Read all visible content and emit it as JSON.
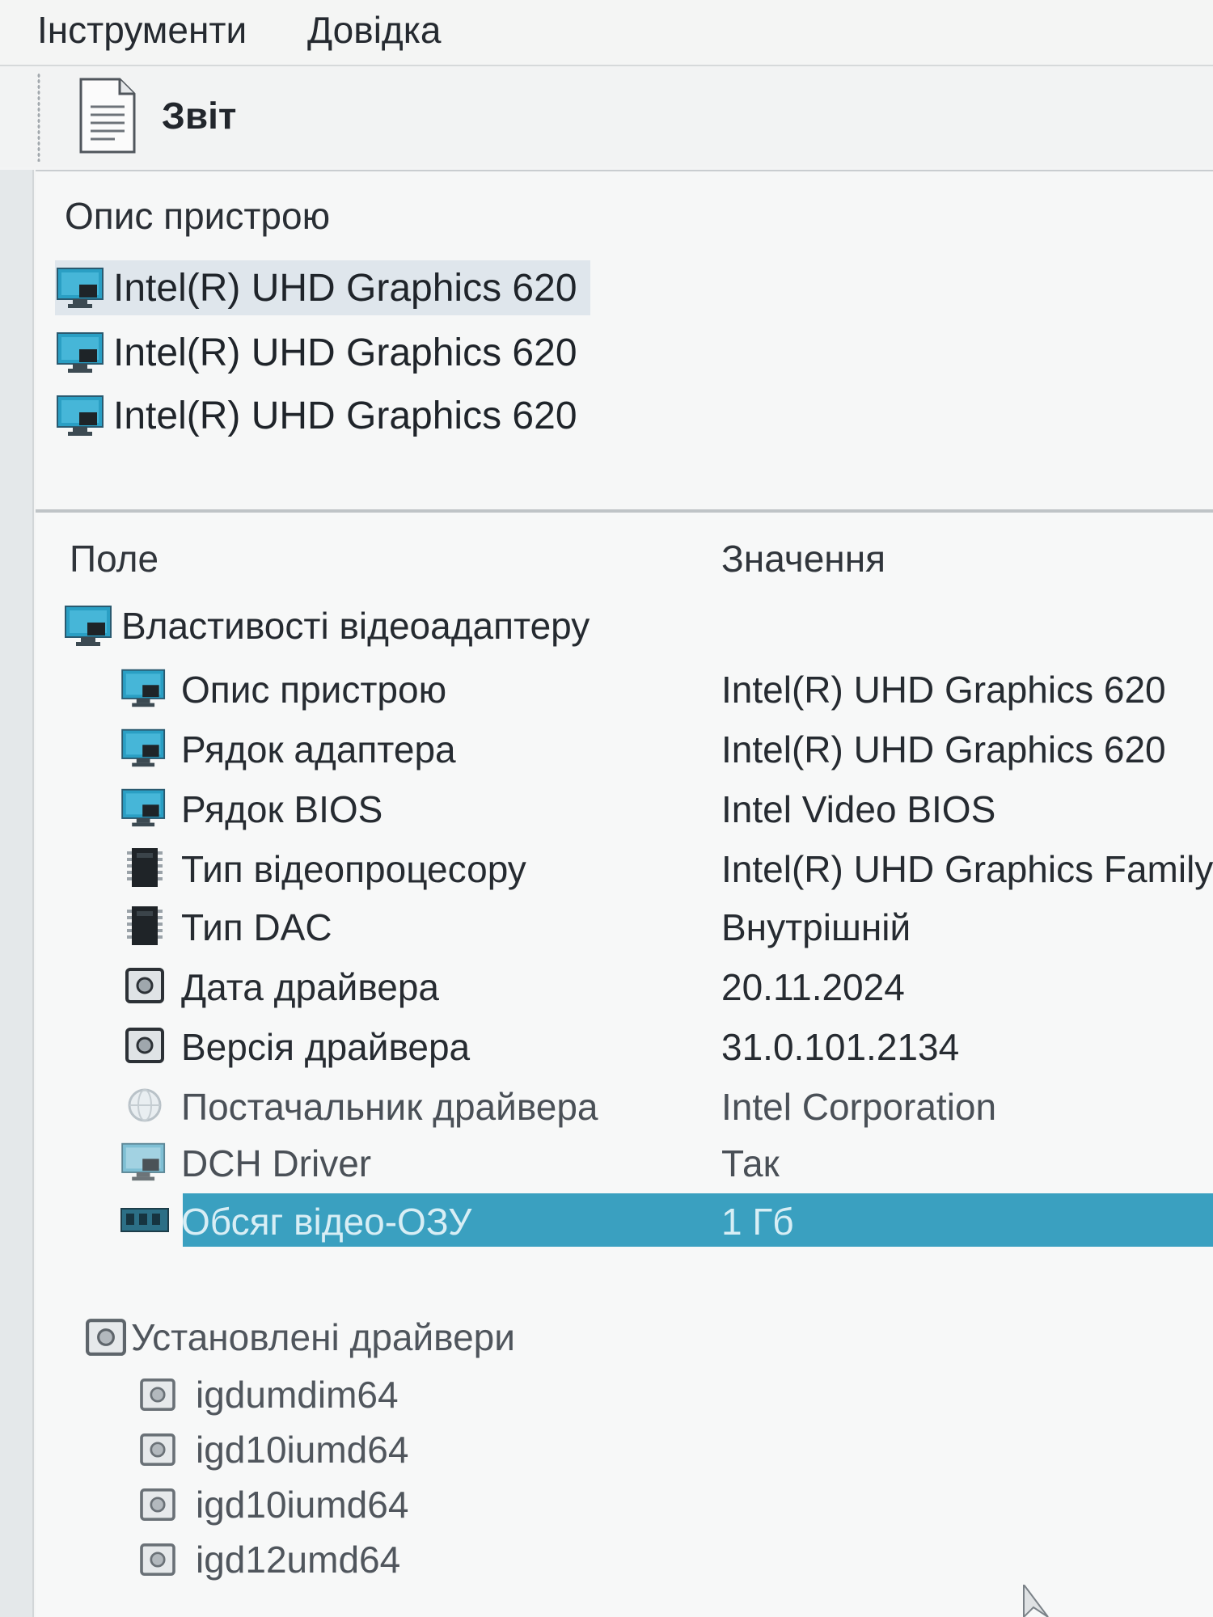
{
  "menu": {
    "tools": "Інструменти",
    "help": "Довідка"
  },
  "toolbar": {
    "report_label": "Звіт",
    "report_icon": "document-icon"
  },
  "device_panel": {
    "header": "Опис пристрою",
    "items": [
      {
        "label": "Intel(R) UHD Graphics 620",
        "icon": "monitor-icon",
        "selected": true
      },
      {
        "label": "Intel(R) UHD Graphics 620",
        "icon": "monitor-icon",
        "selected": false
      },
      {
        "label": "Intel(R) UHD Graphics 620",
        "icon": "monitor-icon",
        "selected": false
      }
    ]
  },
  "properties": {
    "columns": {
      "field": "Поле",
      "value": "Значення"
    },
    "group": {
      "label": "Властивості відеоадаптеру",
      "icon": "monitor-icon"
    },
    "rows": [
      {
        "field": "Опис пристрою",
        "value": "Intel(R) UHD Graphics 620",
        "icon": "monitor-icon"
      },
      {
        "field": "Рядок адаптера",
        "value": "Intel(R) UHD Graphics 620",
        "icon": "monitor-icon"
      },
      {
        "field": "Рядок BIOS",
        "value": "Intel Video BIOS",
        "icon": "monitor-icon"
      },
      {
        "field": "Тип відеопроцесору",
        "value": "Intel(R) UHD Graphics Family",
        "icon": "chip-icon"
      },
      {
        "field": "Тип DAC",
        "value": "Внутрішній",
        "icon": "chip-icon"
      },
      {
        "field": "Дата драйвера",
        "value": "20.11.2024",
        "icon": "driver-icon"
      },
      {
        "field": "Версія драйвера",
        "value": "31.0.101.2134",
        "icon": "driver-icon"
      },
      {
        "field": "Постачальник драйвера",
        "value": "Intel Corporation",
        "icon": "globe-icon"
      },
      {
        "field": "DCH Driver",
        "value": "Так",
        "icon": "monitor-icon"
      },
      {
        "field": "Обсяг відео-ОЗУ",
        "value": "1 Гб",
        "icon": "memory-icon",
        "selected": true
      }
    ],
    "drivers_group": {
      "label": "Установлені драйвери",
      "icon": "driver-icon"
    },
    "drivers": [
      {
        "label": "igdumdim64",
        "icon": "driver-icon"
      },
      {
        "label": "igd10iumd64",
        "icon": "driver-icon"
      },
      {
        "label": "igd10iumd64",
        "icon": "driver-icon"
      },
      {
        "label": "igd12umd64",
        "icon": "driver-icon"
      }
    ]
  },
  "colors": {
    "selection": "#3aa0c0",
    "monitor_icon": "#2a9fc4",
    "background": "#f7f8f8"
  }
}
